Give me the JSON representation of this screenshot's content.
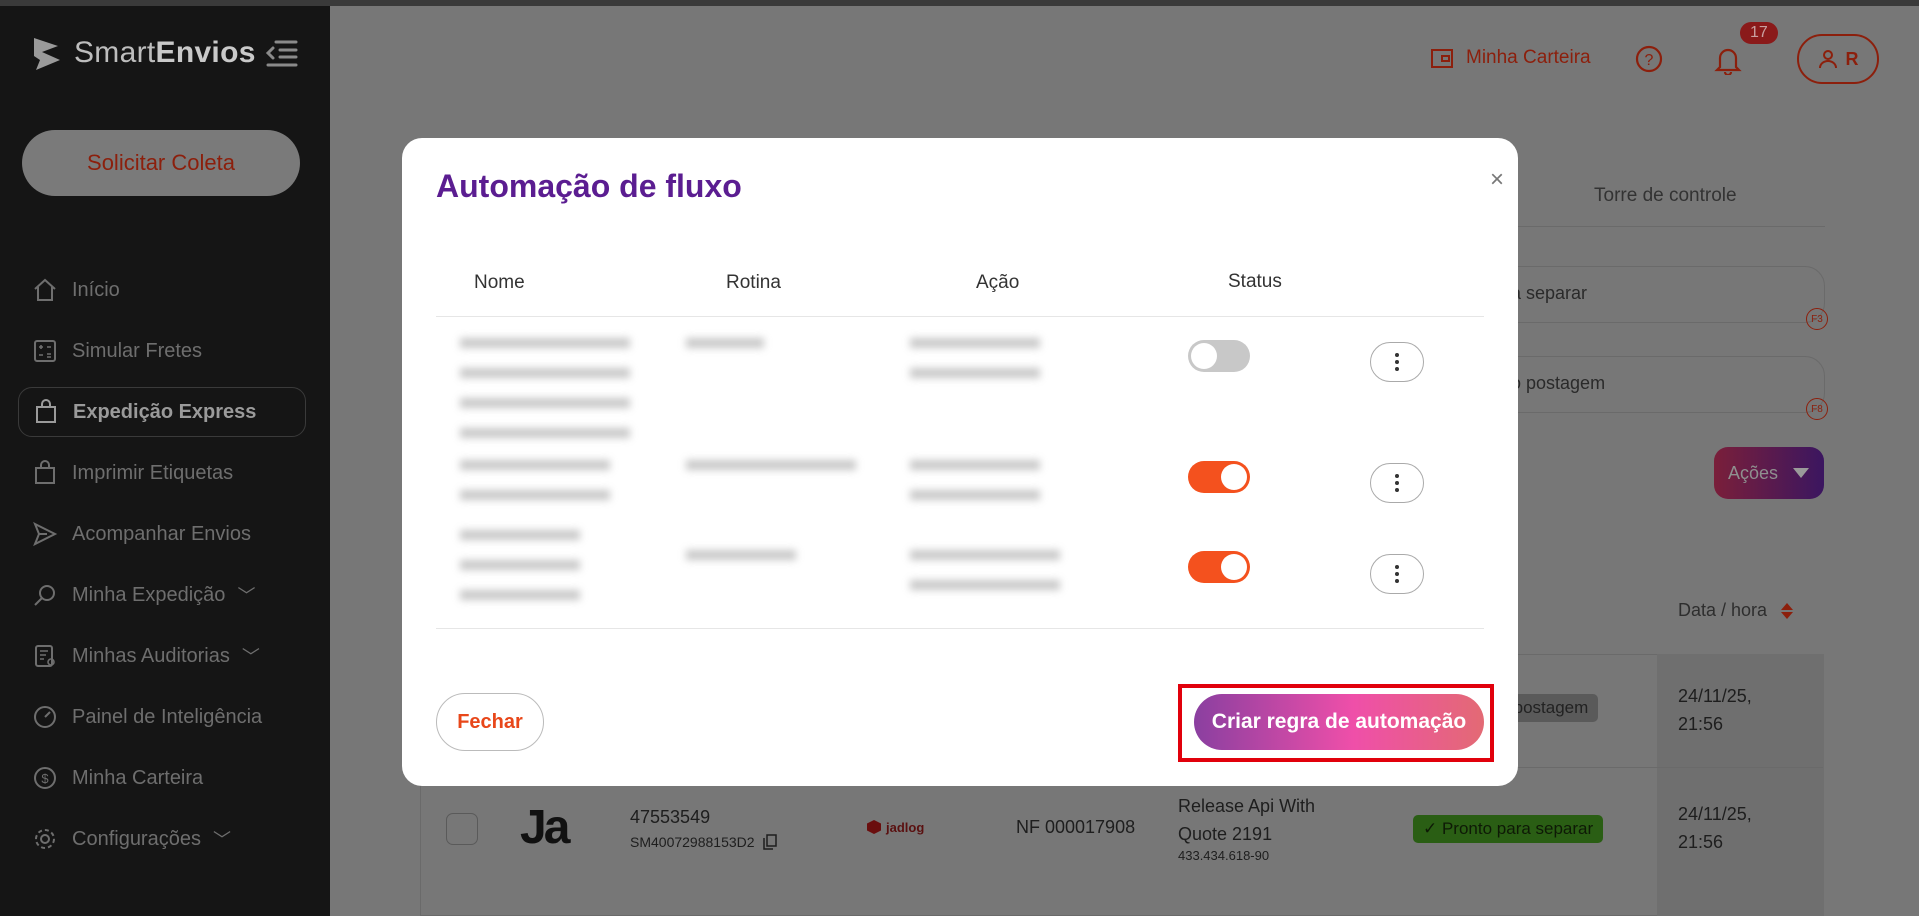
{
  "app": {
    "brand_light": "Smart",
    "brand_bold": "Envios"
  },
  "sidebar": {
    "cta_label": "Solicitar Coleta",
    "items": [
      {
        "label": "Início",
        "icon": "home-icon"
      },
      {
        "label": "Simular Fretes",
        "icon": "calculator-icon"
      },
      {
        "label": "Expedição Express",
        "icon": "bag-icon",
        "active": true
      },
      {
        "label": "Imprimir Etiquetas",
        "icon": "bag-icon"
      },
      {
        "label": "Acompanhar Envios",
        "icon": "send-icon"
      },
      {
        "label": "Minha Expedição",
        "icon": "search-icon",
        "has_submenu": true
      },
      {
        "label": "Minhas Auditorias",
        "icon": "audit-icon",
        "has_submenu": true
      },
      {
        "label": "Painel de Inteligência",
        "icon": "gauge-icon"
      },
      {
        "label": "Minha Carteira",
        "icon": "dollar-icon"
      },
      {
        "label": "Configurações",
        "icon": "gear-icon",
        "has_submenu": true
      }
    ]
  },
  "header": {
    "wallet_label": "Minha Carteira",
    "notifications_count": "17",
    "user_initial": "R"
  },
  "background": {
    "tab_label": "Torre de controle",
    "filter1_label": "a separar",
    "filter1_key": "F3",
    "filter2_label": "o postagem",
    "filter2_key": "F8",
    "actions_label": "Ações",
    "sort_label": "Data / hora",
    "row1": {
      "status": "do postagem",
      "date": "24/11/25,",
      "time": "21:56"
    },
    "row2": {
      "carrier_logo_text": "Ja",
      "order_id": "47553549",
      "tracking_code": "SM40072988153D2",
      "carrier_name": "jadlog",
      "invoice": "NF 000017908",
      "client_line1": "Release Api With",
      "client_line2": "Quote 2191",
      "document": "433.434.618-90",
      "status": "Pronto para separar",
      "date": "24/11/25,",
      "time": "21:56"
    }
  },
  "modal": {
    "title": "Automação de fluxo",
    "close_symbol": "×",
    "columns": {
      "name": "Nome",
      "routine": "Rotina",
      "action": "Ação",
      "status": "Status"
    },
    "rules": [
      {
        "status_on": false
      },
      {
        "status_on": true
      },
      {
        "status_on": true
      }
    ],
    "close_button": "Fechar",
    "create_button": "Criar regra de automação"
  },
  "colors": {
    "accent": "#f4511e",
    "brand_purple": "#5b1d91",
    "highlight": "#e1000c"
  }
}
